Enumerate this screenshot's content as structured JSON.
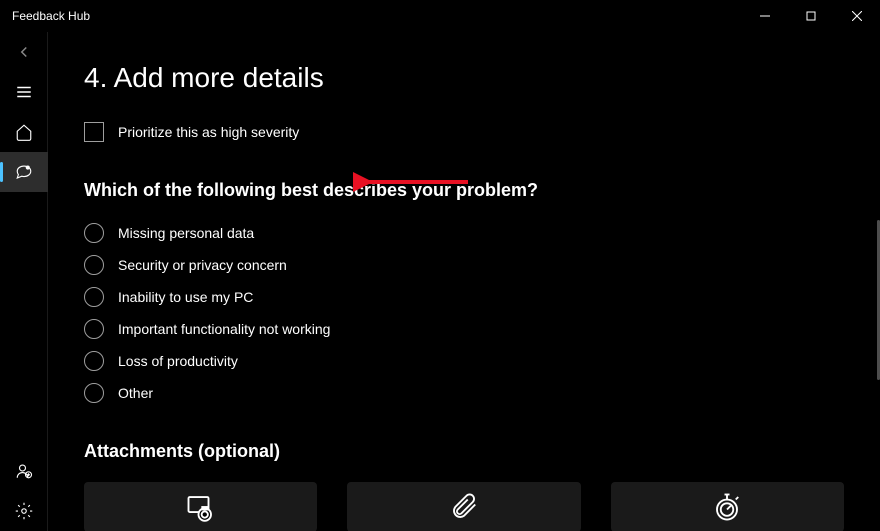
{
  "titlebar": {
    "title": "Feedback Hub"
  },
  "main": {
    "section_title": "4. Add more details",
    "checkbox_label": "Prioritize this as high severity",
    "question": "Which of the following best describes your problem?",
    "radio_options": [
      "Missing personal data",
      "Security or privacy concern",
      "Inability to use my PC",
      "Important functionality not working",
      "Loss of productivity",
      "Other"
    ],
    "attachments_title": "Attachments (optional)"
  }
}
